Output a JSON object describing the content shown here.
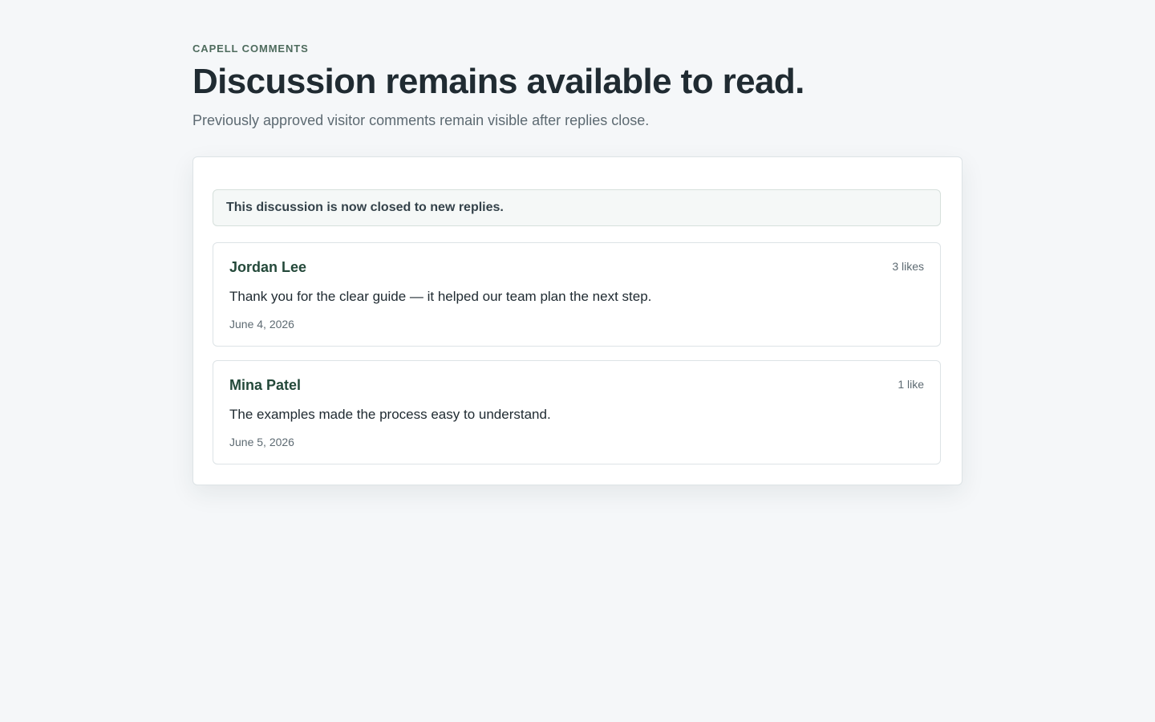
{
  "header": {
    "eyebrow": "CAPELL COMMENTS",
    "title": "Discussion remains available to read.",
    "subtitle": "Previously approved visitor comments remain visible after replies close."
  },
  "notice": {
    "text": "This discussion is now closed to new replies."
  },
  "comments": [
    {
      "author": "Jordan Lee",
      "likes": "3 likes",
      "text": "Thank you for the clear guide — it helped our team plan the next step.",
      "date": "June 4, 2026"
    },
    {
      "author": "Mina Patel",
      "likes": "1 like",
      "text": "The examples made the process easy to understand.",
      "date": "June 5, 2026"
    }
  ],
  "colors": {
    "background": "#f5f7f9",
    "accent": "#24493a",
    "eyebrow": "#4e6b5d",
    "text_primary": "#202b32",
    "text_muted": "#5d6a72"
  }
}
